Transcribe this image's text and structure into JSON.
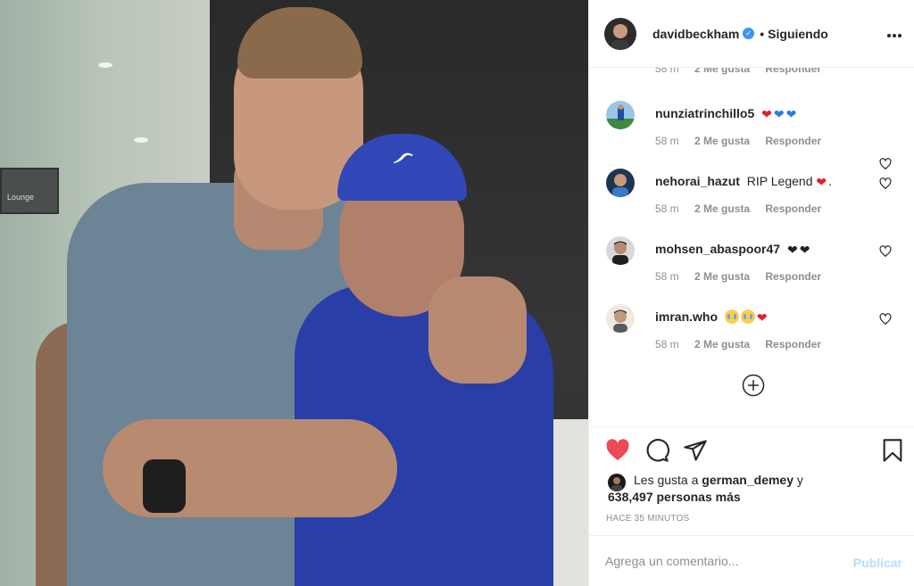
{
  "post": {
    "author": "davidbeckham",
    "separator": "•",
    "follow_status": "Siguiendo",
    "more_icon": "more-horizontal-icon"
  },
  "photo": {
    "sign_text": "Lounge",
    "cap_logo": "puma-logo"
  },
  "partial_comment_meta": {
    "time": "58 m",
    "likes": "2 Me gusta",
    "reply": "Responder"
  },
  "comments": [
    {
      "user": "nunziatrinchillo5",
      "text": "",
      "emoji": [
        "red-heart",
        "blue-heart",
        "blue-heart"
      ],
      "time": "58 m",
      "likes": "2 Me gusta",
      "reply": "Responder"
    },
    {
      "user": "nehorai_hazut",
      "text": "RIP Legend",
      "text_after": ".",
      "emoji": [
        "red-heart"
      ],
      "time": "58 m",
      "likes": "2 Me gusta",
      "reply": "Responder"
    },
    {
      "user": "mohsen_abaspoor47",
      "text": "",
      "emoji": [
        "black-heart",
        "black-heart"
      ],
      "time": "58 m",
      "likes": "2 Me gusta",
      "reply": "Responder"
    },
    {
      "user": "imran.who",
      "text": "",
      "emoji": [
        "crying-face",
        "crying-face",
        "red-heart"
      ],
      "time": "58 m",
      "likes": "2 Me gusta",
      "reply": "Responder"
    }
  ],
  "load_more_icon": "plus-circle-icon",
  "actions": {
    "like_icon": "heart-filled-icon",
    "comment_icon": "comment-icon",
    "share_icon": "paper-plane-icon",
    "save_icon": "bookmark-icon"
  },
  "likes": {
    "prefix": "Les gusta a",
    "user": "german_demey",
    "conjunction": "y",
    "count_text": "638,497 personas más"
  },
  "time_ago": "HACE 35 MINUTOS",
  "add_comment": {
    "placeholder": "Agrega un comentario...",
    "publish_label": "Publicar"
  },
  "colors": {
    "text": "#262626",
    "secondary": "#8e8e8e",
    "like_red": "#ed4956",
    "verified_blue": "#3897f0",
    "publish_disabled": "#b2dffc",
    "border": "#efefef"
  }
}
